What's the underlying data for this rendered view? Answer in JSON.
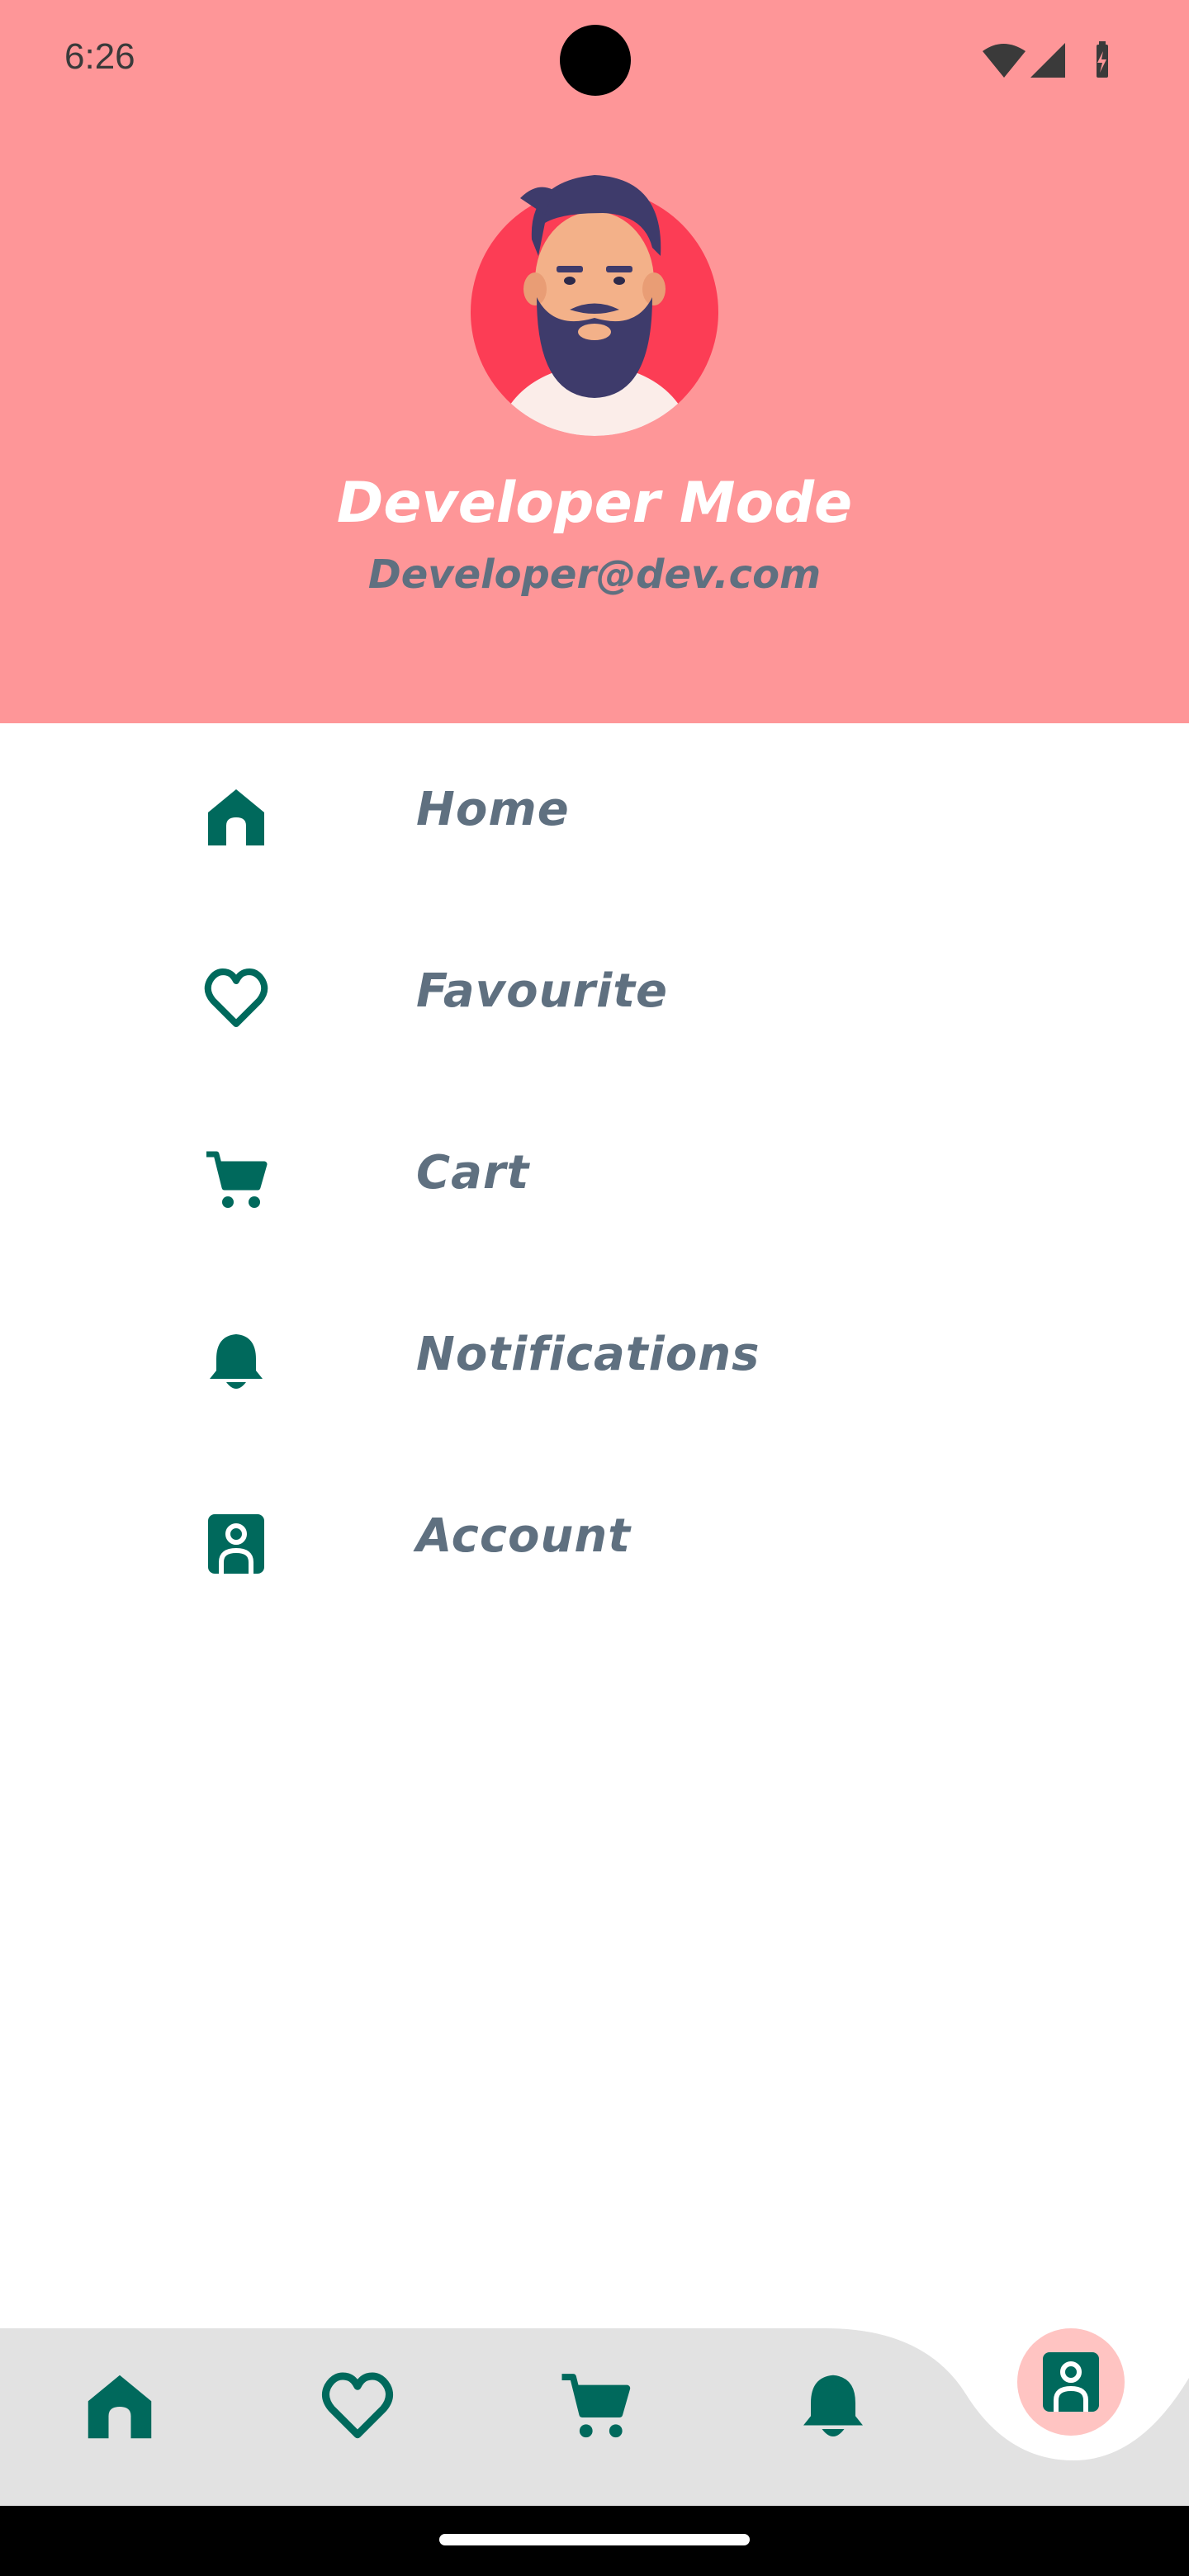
{
  "status_bar": {
    "time": "6:26",
    "icons": [
      "wifi-icon",
      "signal-icon",
      "battery-icon"
    ]
  },
  "profile": {
    "name": "Developer Mode",
    "email": "Developer@dev.com",
    "avatar": "bearded-man-avatar"
  },
  "menu": {
    "items": [
      {
        "label": "Home",
        "icon": "home-icon"
      },
      {
        "label": "Favourite",
        "icon": "heart-icon"
      },
      {
        "label": "Cart",
        "icon": "cart-icon"
      },
      {
        "label": "Notifications",
        "icon": "bell-icon"
      },
      {
        "label": "Account",
        "icon": "account-icon"
      }
    ]
  },
  "bottom_nav": {
    "items": [
      "home-icon",
      "heart-icon",
      "cart-icon",
      "bell-icon",
      "account-icon"
    ],
    "selected": "account-icon"
  },
  "colors": {
    "header_bg": "#fe9698",
    "accent": "#00695c",
    "label_text": "#5f7080",
    "fab_bg": "#ffc4c2",
    "nav_bg": "#e2e2e2"
  }
}
